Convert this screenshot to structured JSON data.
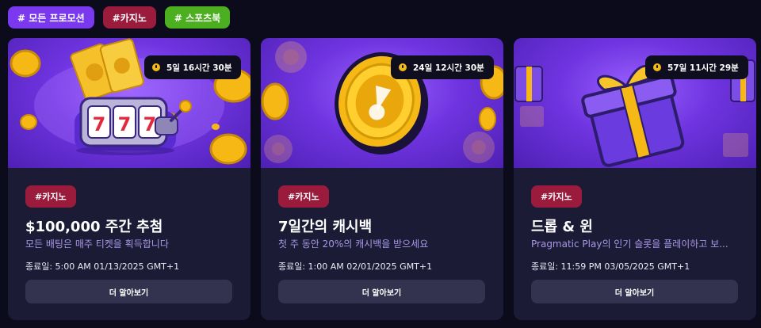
{
  "filters": [
    {
      "label": "# 모든 프로모션"
    },
    {
      "label": "#카지노"
    },
    {
      "label": "# 스포츠북"
    }
  ],
  "cards": [
    {
      "timer": "5일 16시간 30분",
      "tag": "#카지노",
      "title": "$100,000 주간 추첨",
      "description": "모든 배팅은 매주 티켓을 획득합니다",
      "end_date": "종료일: 5:00 AM 01/13/2025 GMT+1",
      "button": "더 알아보기",
      "image_icon": "slot-machine-icon",
      "slot_text": "777"
    },
    {
      "timer": "24일 12시간 30분",
      "tag": "#카지노",
      "title": "7일간의 캐시백",
      "description": "첫 주 동안 20%의 캐시백을 받으세요",
      "end_date": "종료일: 1:00 AM 02/01/2025 GMT+1",
      "button": "더 알아보기",
      "image_icon": "gold-coin-icon"
    },
    {
      "timer": "57일 11시간 29분",
      "tag": "#카지노",
      "title": "드롭 & 윈",
      "description": "Pragmatic Play의 인기 슬롯을 플레이하고 보...",
      "end_date": "종료일: 11:59 PM 03/05/2025 GMT+1",
      "button": "더 알아보기",
      "image_icon": "gift-box-icon"
    }
  ],
  "colors": {
    "background": "#0b0b1c",
    "card": "#1b1b36",
    "accent_purple": "#7a39ee",
    "tag_red": "#9b1b3d",
    "tag_green": "#4caf1f",
    "gold": "#f2bb1a",
    "desc_text": "#a897e6"
  }
}
